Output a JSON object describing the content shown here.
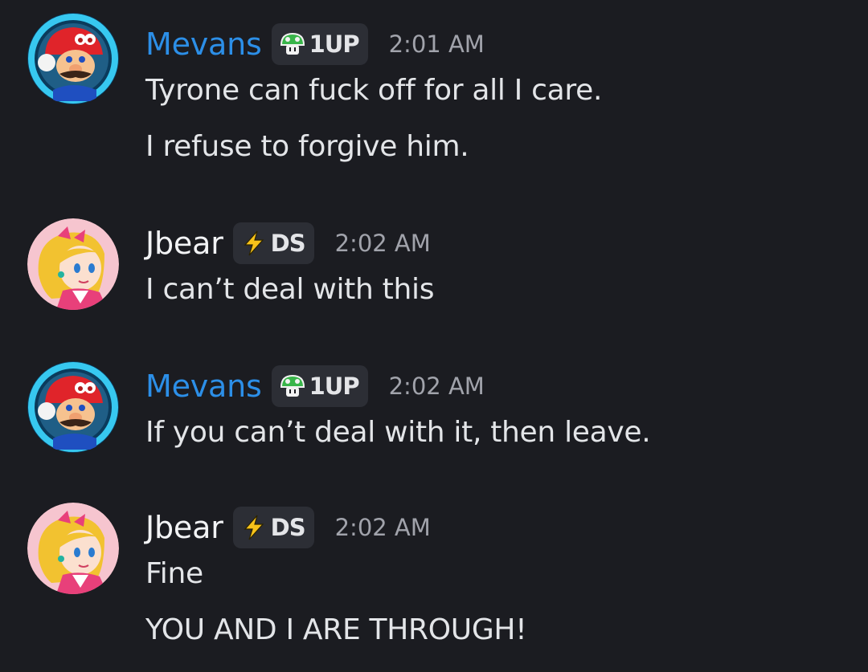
{
  "colors": {
    "background": "#1b1c21",
    "mevans_name": "#2c8fe8",
    "jbear_name": "#f2f3f5",
    "tag_background": "#2c2e35",
    "timestamp": "#a1a3ab",
    "message_text": "#e3e5e8"
  },
  "messages": [
    {
      "username": "Mevans",
      "avatar": "mario-avatar",
      "tag": {
        "icon": "green-mushroom-icon",
        "text": "1UP"
      },
      "timestamp": "2:01 AM",
      "lines": [
        "Tyrone can fuck off for all I care.",
        "I refuse to forgive him."
      ]
    },
    {
      "username": "Jbear",
      "avatar": "peach-avatar",
      "tag": {
        "icon": "lightning-bolt-icon",
        "text": "DS"
      },
      "timestamp": "2:02 AM",
      "lines": [
        "I can’t deal with this"
      ]
    },
    {
      "username": "Mevans",
      "avatar": "mario-avatar",
      "tag": {
        "icon": "green-mushroom-icon",
        "text": "1UP"
      },
      "timestamp": "2:02 AM",
      "lines": [
        "If you can’t deal with it, then leave."
      ]
    },
    {
      "username": "Jbear",
      "avatar": "peach-avatar",
      "tag": {
        "icon": "lightning-bolt-icon",
        "text": "DS"
      },
      "timestamp": "2:02 AM",
      "lines": [
        "Fine",
        "YOU AND I ARE THROUGH!"
      ]
    }
  ]
}
